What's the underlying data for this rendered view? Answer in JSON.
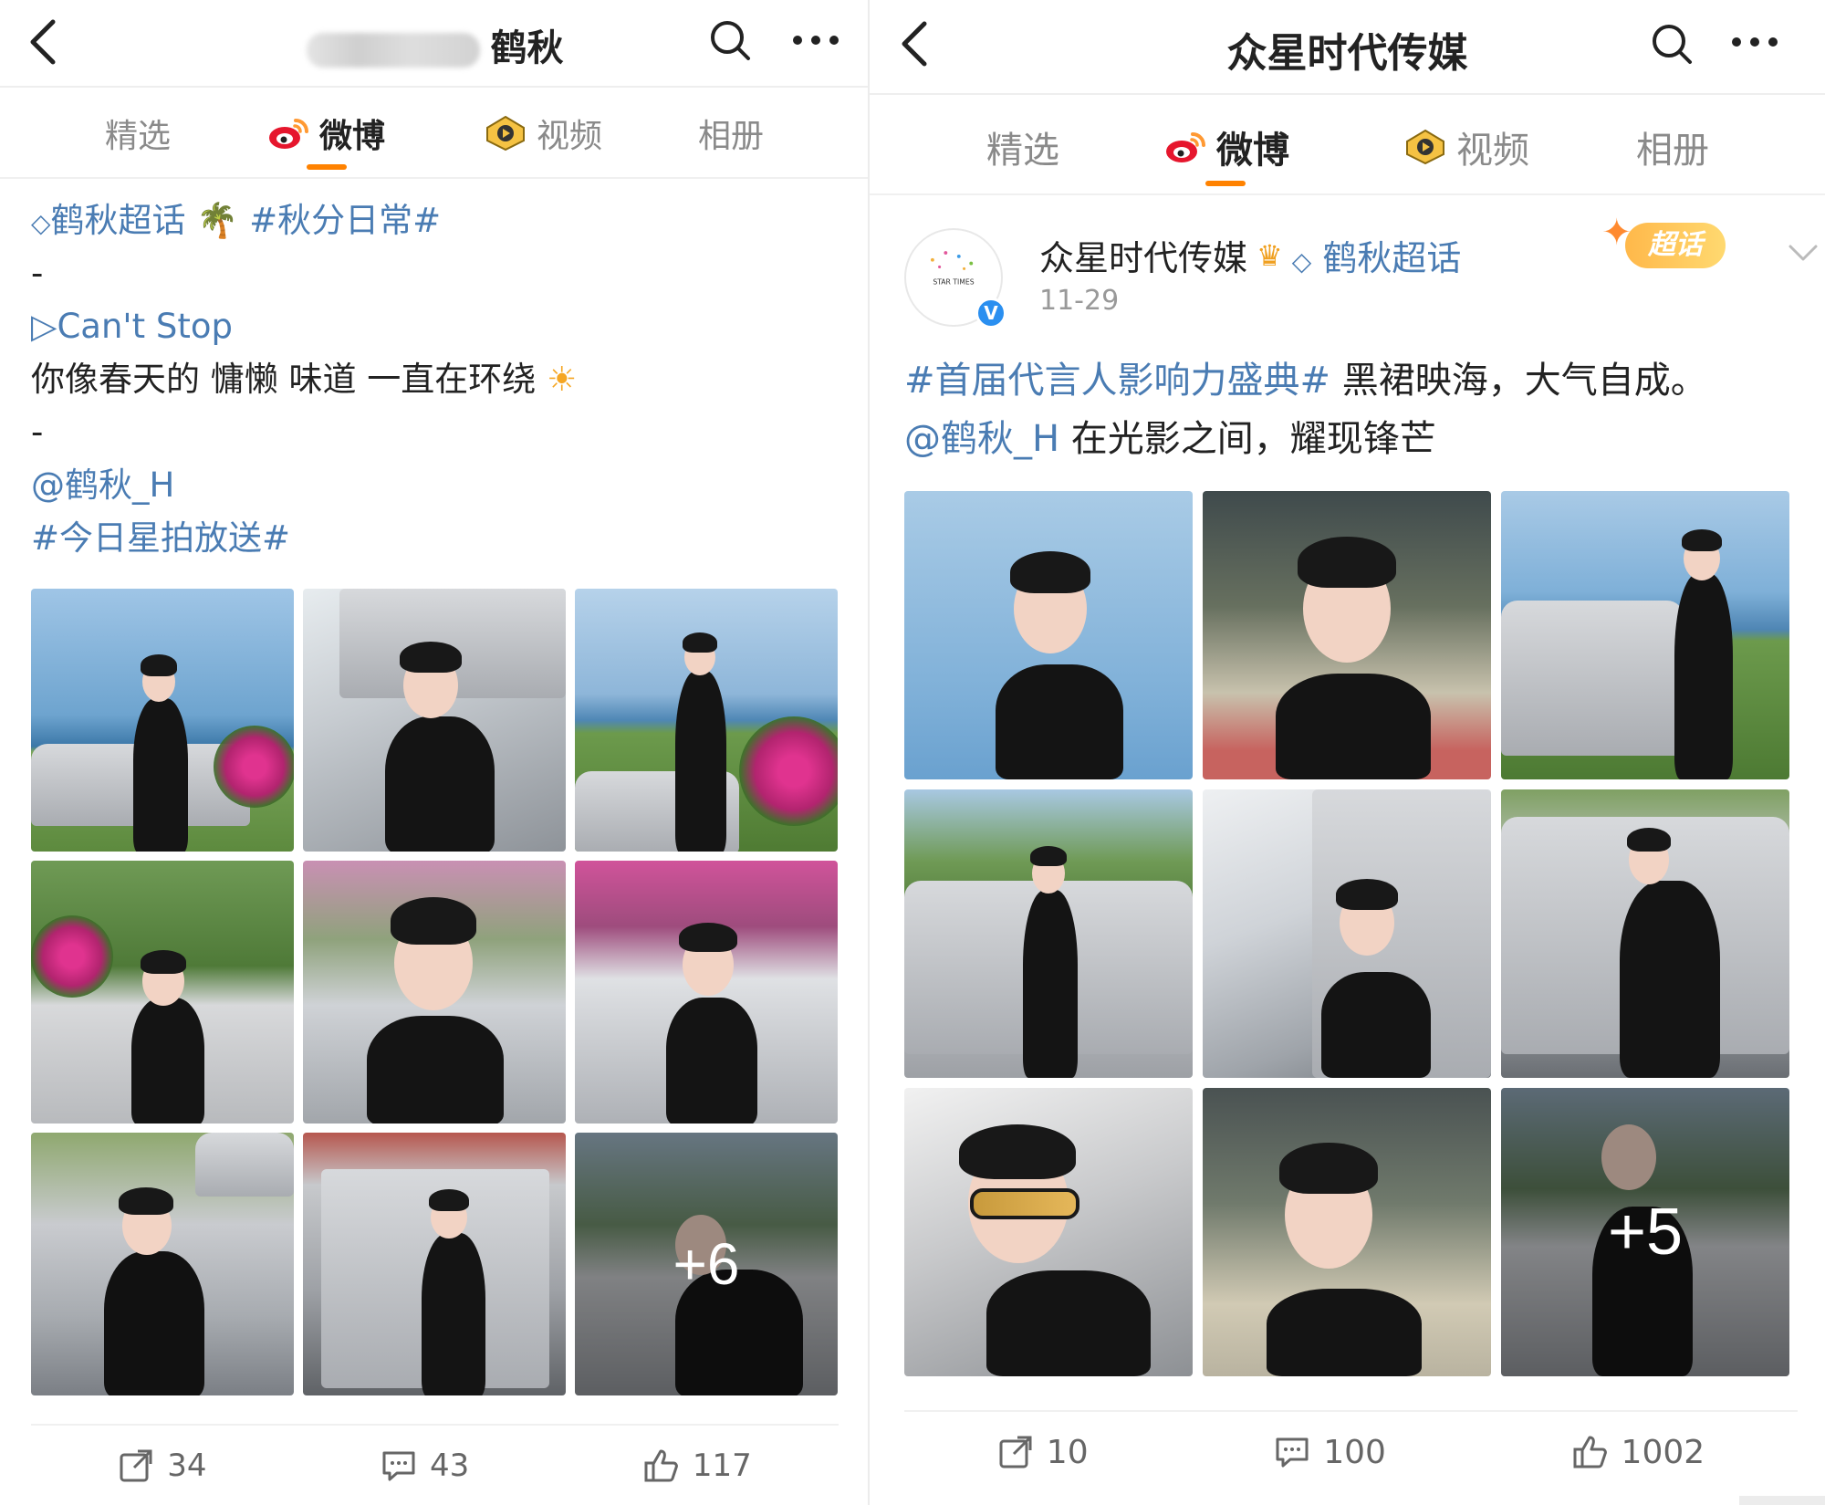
{
  "left": {
    "header": {
      "title": "鹤秋"
    },
    "tabs": [
      {
        "label": "精选"
      },
      {
        "label": "微博"
      },
      {
        "label": "视频"
      },
      {
        "label": "相册"
      }
    ],
    "post": {
      "supertopic": "鹤秋超话",
      "hashtag_1": "#秋分日常#",
      "dash_1": "-",
      "song": "▷Can't Stop",
      "lyric": "你像春天的 慵懒 味道 一直在环绕",
      "dash_2": "-",
      "mention": "@鹤秋_H",
      "hashtag_2": "#今日星拍放送#",
      "more_count": "+6"
    },
    "actions": {
      "repost": "34",
      "comment": "43",
      "like": "117"
    }
  },
  "right": {
    "header": {
      "title": "众星时代传媒"
    },
    "tabs": [
      {
        "label": "精选"
      },
      {
        "label": "微博"
      },
      {
        "label": "视频"
      },
      {
        "label": "相册"
      }
    ],
    "post": {
      "author": "众星时代传媒",
      "supertopic": "鹤秋超话",
      "date": "11-29",
      "badge": "超话",
      "avatar_text": "STAR TIMES",
      "hashtag": "#首届代言人影响力盛典#",
      "text_1": " 黑裙映海，大气自成。",
      "mention": "@鹤秋_H",
      "text_2": " 在光影之间，耀现锋芒",
      "more_count": "+5"
    },
    "actions": {
      "repost": "10",
      "comment": "100",
      "like": "1002"
    }
  },
  "colors": {
    "accent": "#ff8200",
    "link": "#4a7cb3",
    "muted": "#8a8a8a"
  }
}
